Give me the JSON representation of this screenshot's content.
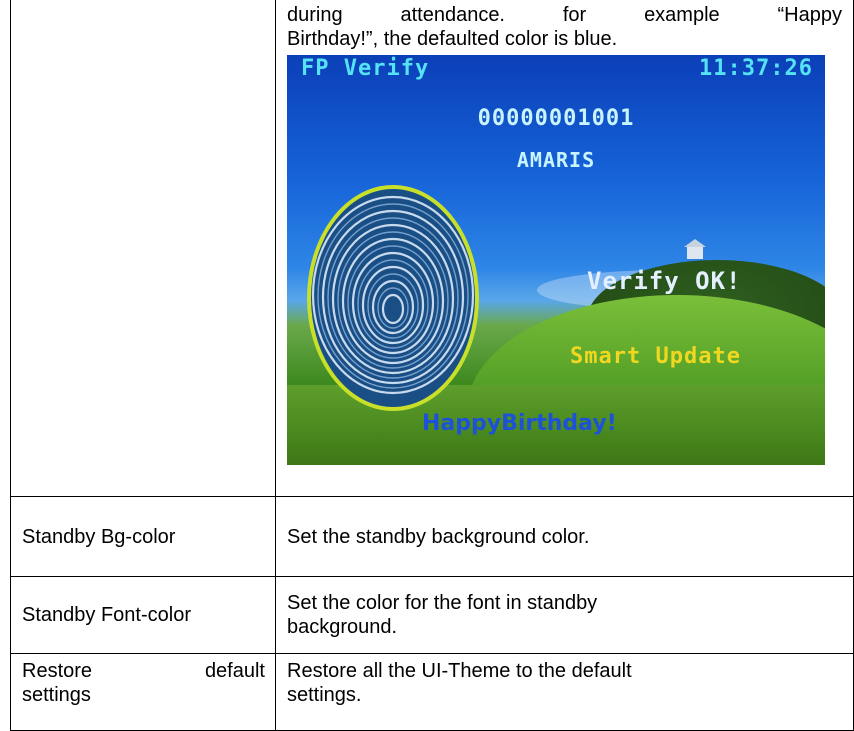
{
  "document": {
    "intro_line1": "during attendance. for example “Happy",
    "intro_line2": "Birthday!”, the defaulted color is blue.",
    "screen": {
      "mode": "FP Verify",
      "time": "11:37:26",
      "user_id": "00000001001",
      "user_name": "AMARIS",
      "verify_status": "Verify OK!",
      "smart_update": "Smart Update",
      "birthday_message": "HappyBirthday!",
      "colors": {
        "header_text": "#55e2f5",
        "smart_update_text": "#f0d820",
        "birthday_text": "#1d52d8",
        "fingerprint_ring": "#c8e02a"
      },
      "icons": [
        "fingerprint-icon"
      ]
    },
    "rows": [
      {
        "setting": "Standby Bg-color",
        "description": "Set the standby background color."
      },
      {
        "setting": "Standby Font-color",
        "description_line1": "Set the color for the font in standby",
        "description_line2": "background."
      },
      {
        "setting_word1": "Restore",
        "setting_word2": "default",
        "setting_line2": "settings",
        "description_line1": "Restore all the UI-Theme to the default",
        "description_line2": "settings."
      }
    ]
  }
}
